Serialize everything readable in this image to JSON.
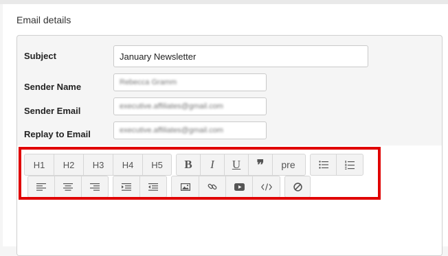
{
  "section": {
    "title": "Email details"
  },
  "form": {
    "subject_label": "Subject",
    "subject_value": "January Newsletter",
    "sender_name_label": "Sender Name",
    "sender_name_value": "Rebecca Gramm",
    "sender_email_label": "Sender Email",
    "sender_email_value": "executive.affiliates@gmail.com",
    "reply_email_label": "Replay to Email",
    "reply_email_value": "executive.affiliates@gmail.com"
  },
  "toolbar": {
    "headings": [
      "H1",
      "H2",
      "H3",
      "H4",
      "H5"
    ],
    "bold": "B",
    "italic": "I",
    "underline": "U",
    "quote": "❞",
    "pre": "pre"
  },
  "colors": {
    "highlight": "#e00000"
  }
}
